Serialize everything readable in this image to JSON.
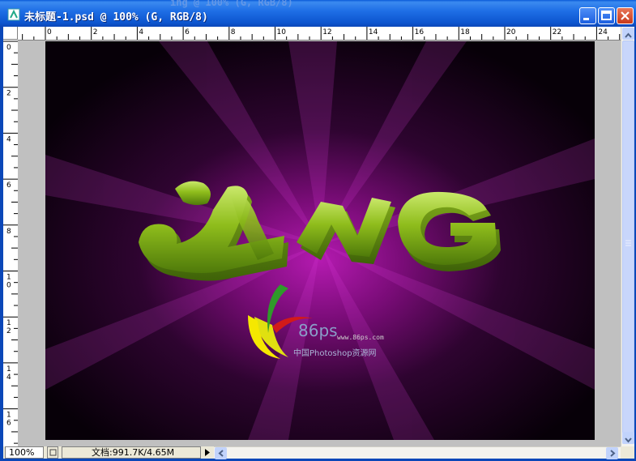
{
  "window": {
    "title": "未标题-1.psd @ 100% (G, RGB/8)",
    "ghost_title": "ing @ 100% (G, RGB/8)"
  },
  "ruler": {
    "h_labels": [
      "0",
      "2",
      "4",
      "6",
      "8",
      "10",
      "12",
      "14",
      "16",
      "18",
      "20",
      "22",
      "24"
    ],
    "v_labels": [
      "0",
      "2",
      "4",
      "6",
      "8",
      "10",
      "12",
      "14",
      "16"
    ]
  },
  "canvas": {
    "logo": {
      "brand": "86ps",
      "url": "www.86ps.com",
      "caption": "中国Photoshop资源网"
    },
    "text_art": "YNG"
  },
  "status": {
    "zoom": "100%",
    "doc_info": "文档:991.7K/4.65M"
  },
  "colors": {
    "titlebar": "#1f6fe6",
    "canvas_bg": "#0b0010",
    "glow": "#a0139e",
    "letters": "#8fbd1c"
  }
}
